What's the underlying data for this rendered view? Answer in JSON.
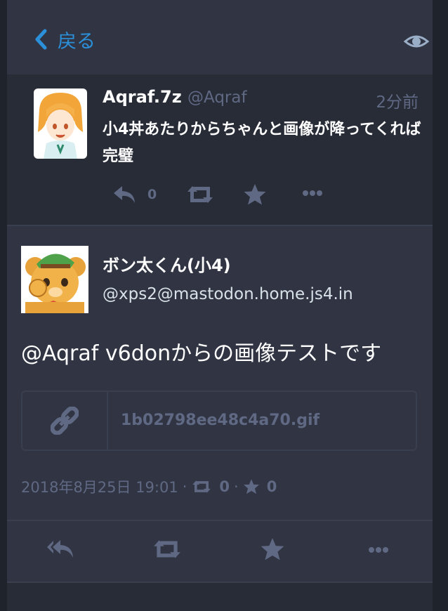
{
  "header": {
    "back_label": "戻る"
  },
  "reply_status": {
    "display_name": "Aqraf.7z",
    "handle": "@Aqraf",
    "time": "2分前",
    "content": "小4丼あたりからちゃんと画像が降ってくれば完璧",
    "reply_count": "0"
  },
  "detail": {
    "display_name": "ボン太くん(小4)",
    "acct": "@xps2@mastodon.home.js4.in",
    "content": "@Aqraf v6donからの画像テストです",
    "attachment": {
      "filename": "1b02798ee48c4a70.gif"
    },
    "timestamp": "2018年8月25日 19:01",
    "sep": "·",
    "boost_count": "0",
    "favourite_count": "0"
  },
  "colors": {
    "accent": "#2b90d9",
    "muted": "#606984",
    "bg": "#282c37",
    "panel": "#313543"
  },
  "icons": [
    "chevron-left-icon",
    "eye-icon",
    "reply-icon",
    "boost-icon",
    "star-icon",
    "ellipsis-icon",
    "link-icon",
    "reply-all-icon"
  ]
}
